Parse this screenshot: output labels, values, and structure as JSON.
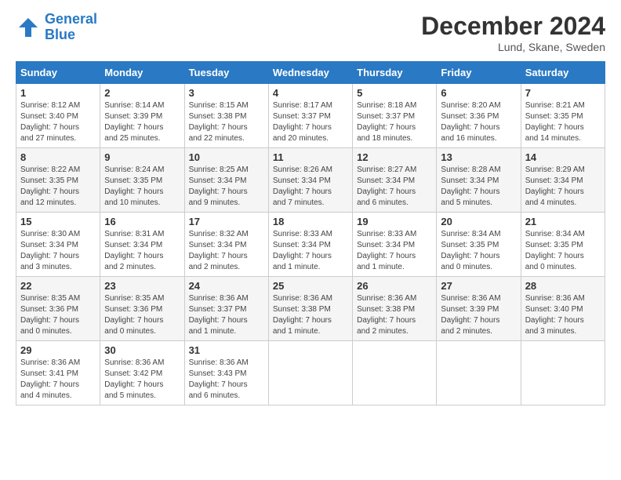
{
  "header": {
    "logo_line1": "General",
    "logo_line2": "Blue",
    "month": "December 2024",
    "location": "Lund, Skane, Sweden"
  },
  "days_of_week": [
    "Sunday",
    "Monday",
    "Tuesday",
    "Wednesday",
    "Thursday",
    "Friday",
    "Saturday"
  ],
  "weeks": [
    [
      {
        "day": "1",
        "detail": "Sunrise: 8:12 AM\nSunset: 3:40 PM\nDaylight: 7 hours\nand 27 minutes."
      },
      {
        "day": "2",
        "detail": "Sunrise: 8:14 AM\nSunset: 3:39 PM\nDaylight: 7 hours\nand 25 minutes."
      },
      {
        "day": "3",
        "detail": "Sunrise: 8:15 AM\nSunset: 3:38 PM\nDaylight: 7 hours\nand 22 minutes."
      },
      {
        "day": "4",
        "detail": "Sunrise: 8:17 AM\nSunset: 3:37 PM\nDaylight: 7 hours\nand 20 minutes."
      },
      {
        "day": "5",
        "detail": "Sunrise: 8:18 AM\nSunset: 3:37 PM\nDaylight: 7 hours\nand 18 minutes."
      },
      {
        "day": "6",
        "detail": "Sunrise: 8:20 AM\nSunset: 3:36 PM\nDaylight: 7 hours\nand 16 minutes."
      },
      {
        "day": "7",
        "detail": "Sunrise: 8:21 AM\nSunset: 3:35 PM\nDaylight: 7 hours\nand 14 minutes."
      }
    ],
    [
      {
        "day": "8",
        "detail": "Sunrise: 8:22 AM\nSunset: 3:35 PM\nDaylight: 7 hours\nand 12 minutes."
      },
      {
        "day": "9",
        "detail": "Sunrise: 8:24 AM\nSunset: 3:35 PM\nDaylight: 7 hours\nand 10 minutes."
      },
      {
        "day": "10",
        "detail": "Sunrise: 8:25 AM\nSunset: 3:34 PM\nDaylight: 7 hours\nand 9 minutes."
      },
      {
        "day": "11",
        "detail": "Sunrise: 8:26 AM\nSunset: 3:34 PM\nDaylight: 7 hours\nand 7 minutes."
      },
      {
        "day": "12",
        "detail": "Sunrise: 8:27 AM\nSunset: 3:34 PM\nDaylight: 7 hours\nand 6 minutes."
      },
      {
        "day": "13",
        "detail": "Sunrise: 8:28 AM\nSunset: 3:34 PM\nDaylight: 7 hours\nand 5 minutes."
      },
      {
        "day": "14",
        "detail": "Sunrise: 8:29 AM\nSunset: 3:34 PM\nDaylight: 7 hours\nand 4 minutes."
      }
    ],
    [
      {
        "day": "15",
        "detail": "Sunrise: 8:30 AM\nSunset: 3:34 PM\nDaylight: 7 hours\nand 3 minutes."
      },
      {
        "day": "16",
        "detail": "Sunrise: 8:31 AM\nSunset: 3:34 PM\nDaylight: 7 hours\nand 2 minutes."
      },
      {
        "day": "17",
        "detail": "Sunrise: 8:32 AM\nSunset: 3:34 PM\nDaylight: 7 hours\nand 2 minutes."
      },
      {
        "day": "18",
        "detail": "Sunrise: 8:33 AM\nSunset: 3:34 PM\nDaylight: 7 hours\nand 1 minute."
      },
      {
        "day": "19",
        "detail": "Sunrise: 8:33 AM\nSunset: 3:34 PM\nDaylight: 7 hours\nand 1 minute."
      },
      {
        "day": "20",
        "detail": "Sunrise: 8:34 AM\nSunset: 3:35 PM\nDaylight: 7 hours\nand 0 minutes."
      },
      {
        "day": "21",
        "detail": "Sunrise: 8:34 AM\nSunset: 3:35 PM\nDaylight: 7 hours\nand 0 minutes."
      }
    ],
    [
      {
        "day": "22",
        "detail": "Sunrise: 8:35 AM\nSunset: 3:36 PM\nDaylight: 7 hours\nand 0 minutes."
      },
      {
        "day": "23",
        "detail": "Sunrise: 8:35 AM\nSunset: 3:36 PM\nDaylight: 7 hours\nand 0 minutes."
      },
      {
        "day": "24",
        "detail": "Sunrise: 8:36 AM\nSunset: 3:37 PM\nDaylight: 7 hours\nand 1 minute."
      },
      {
        "day": "25",
        "detail": "Sunrise: 8:36 AM\nSunset: 3:38 PM\nDaylight: 7 hours\nand 1 minute."
      },
      {
        "day": "26",
        "detail": "Sunrise: 8:36 AM\nSunset: 3:38 PM\nDaylight: 7 hours\nand 2 minutes."
      },
      {
        "day": "27",
        "detail": "Sunrise: 8:36 AM\nSunset: 3:39 PM\nDaylight: 7 hours\nand 2 minutes."
      },
      {
        "day": "28",
        "detail": "Sunrise: 8:36 AM\nSunset: 3:40 PM\nDaylight: 7 hours\nand 3 minutes."
      }
    ],
    [
      {
        "day": "29",
        "detail": "Sunrise: 8:36 AM\nSunset: 3:41 PM\nDaylight: 7 hours\nand 4 minutes."
      },
      {
        "day": "30",
        "detail": "Sunrise: 8:36 AM\nSunset: 3:42 PM\nDaylight: 7 hours\nand 5 minutes."
      },
      {
        "day": "31",
        "detail": "Sunrise: 8:36 AM\nSunset: 3:43 PM\nDaylight: 7 hours\nand 6 minutes."
      },
      null,
      null,
      null,
      null
    ]
  ]
}
